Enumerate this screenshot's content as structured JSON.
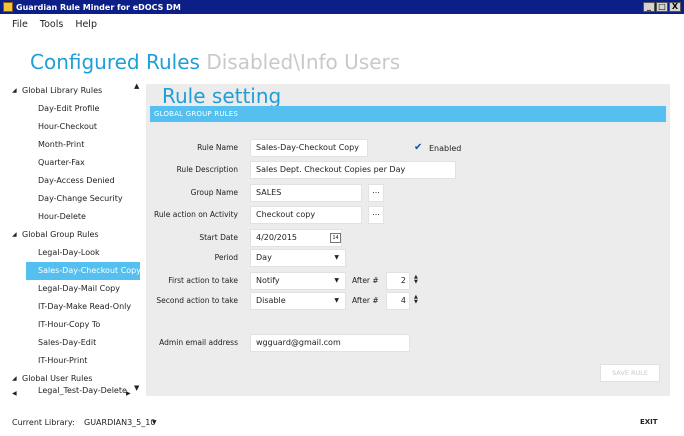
{
  "window": {
    "title": "Guardian Rule Minder for eDOCS DM",
    "minimize": "_",
    "restore": "□",
    "close": "X"
  },
  "menu": [
    "File",
    "Tools",
    "Help"
  ],
  "tabs": {
    "active": "Configured Rules",
    "inactive": "Disabled\\Info Users"
  },
  "tree": {
    "library_group": "Global Library Rules",
    "library_items": [
      "Day-Edit Profile",
      "Hour-Checkout",
      "Month-Print",
      "Quarter-Fax",
      "Day-Access Denied",
      "Day-Change Security",
      "Hour-Delete"
    ],
    "group_group": "Global Group Rules",
    "group_items": [
      "Legal-Day-Look",
      "Sales-Day-Checkout Copy",
      "Legal-Day-Mail Copy",
      "IT-Day-Make Read-Only",
      "IT-Hour-Copy To",
      "Sales-Day-Edit",
      "IT-Hour-Print"
    ],
    "user_group": "Global User Rules",
    "user_items": [
      "Legal_Test-Day-Delete"
    ],
    "selected": "Sales-Day-Checkout Copy"
  },
  "rule": {
    "heading": "Rule setting",
    "section": "GLOBAL GROUP RULES",
    "labels": {
      "rule_name": "Rule Name",
      "rule_description": "Rule Description",
      "group_name": "Group Name",
      "rule_action": "Rule action on Activity",
      "start_date": "Start Date",
      "period": "Period",
      "first_action": "First action to take",
      "second_action": "Second action to take",
      "after1": "After #",
      "after2": "After #",
      "admin_email": "Admin email address",
      "enabled": "Enabled"
    },
    "values": {
      "rule_name": "Sales-Day-Checkout Copy",
      "rule_description": "Sales Dept. Checkout Copies per Day",
      "group_name": "SALES",
      "rule_action": "Checkout copy",
      "start_date": "4/20/2015",
      "period": "Day",
      "first_action": "Notify",
      "first_after": "2",
      "second_action": "Disable",
      "second_after": "4",
      "admin_email": "wgguard@gmail.com",
      "enabled": true
    },
    "browse_label": "...",
    "calendar_label": "14",
    "save_label": "SAVE RULE"
  },
  "footer": {
    "library_label": "Current Library:",
    "library_value": "GUARDIAN3_5_10",
    "exit_label": "EXIT"
  }
}
